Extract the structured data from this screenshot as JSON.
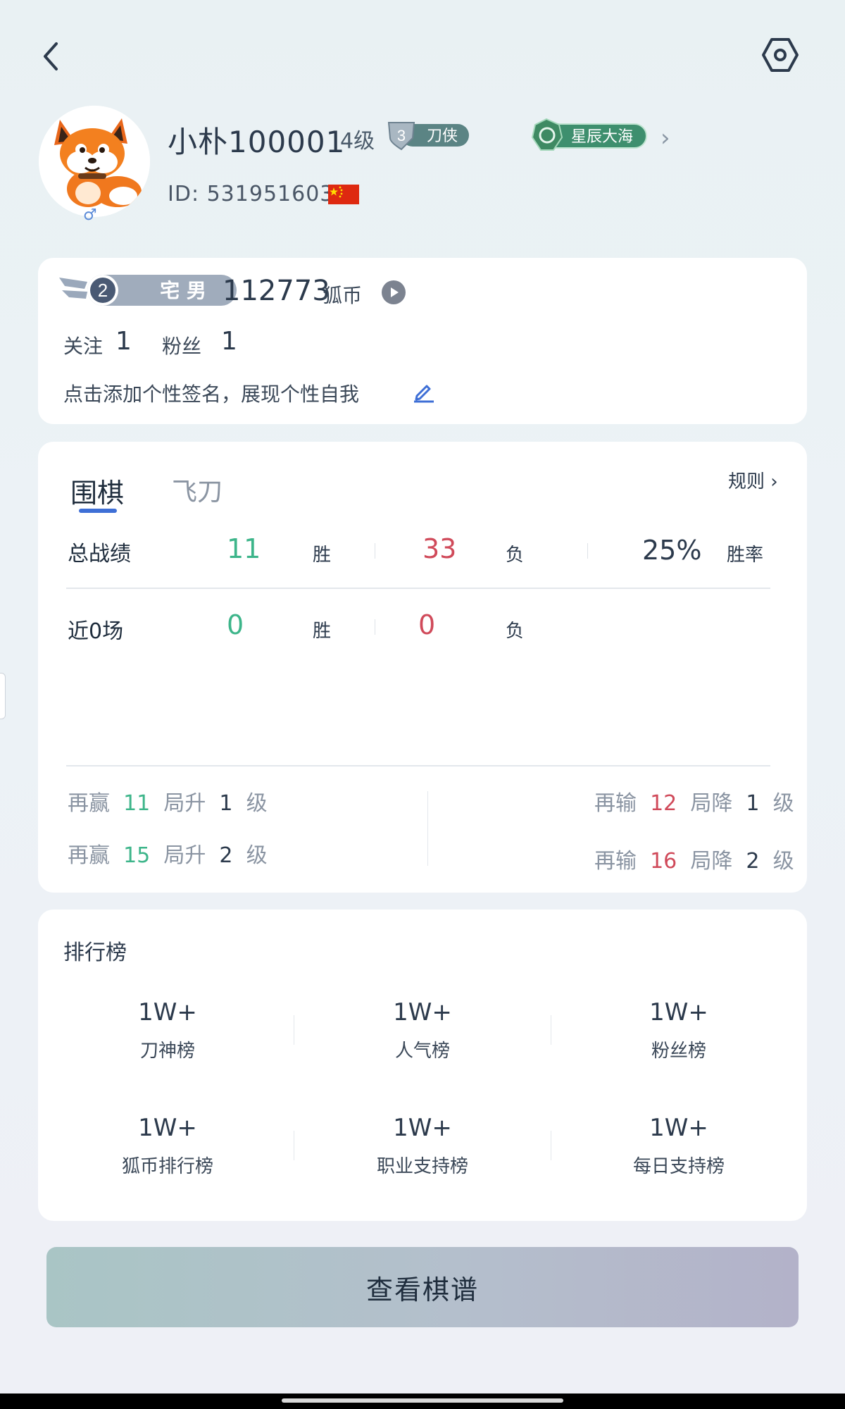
{
  "header": {
    "back_icon": "chevron-left-icon",
    "settings_icon": "hexagon-settings-icon"
  },
  "profile": {
    "username": "小朴100001",
    "level": "4级",
    "rank_badge": {
      "number": "3",
      "label": "刀侠"
    },
    "star_badge": {
      "label": "星辰大海"
    },
    "id_text": "ID: 531951603",
    "gender_symbol": "♂",
    "flag": "china-flag"
  },
  "info_card": {
    "title_badge": {
      "number": "2",
      "label": "宅 男"
    },
    "coins": "112773",
    "coin_label": "狐币",
    "follow_label": "关注",
    "follow_count": "1",
    "fans_label": "粉丝",
    "fans_count": "1",
    "signature": "点击添加个性签名，展现个性自我"
  },
  "stats_card": {
    "tabs": [
      {
        "label": "围棋",
        "active": true
      },
      {
        "label": "飞刀",
        "active": false
      }
    ],
    "rules_label": "规则",
    "total": {
      "label": "总战绩",
      "wins": "11",
      "win_label": "胜",
      "losses": "33",
      "loss_label": "负",
      "rate": "25%",
      "rate_label": "胜率"
    },
    "recent": {
      "label": "近0场",
      "wins": "0",
      "win_label": "胜",
      "losses": "0",
      "loss_label": "负"
    },
    "progress": {
      "up": [
        {
          "pre": "再赢",
          "count": "11",
          "mid": "局升",
          "level": "1",
          "suffix": "级"
        },
        {
          "pre": "再赢",
          "count": "15",
          "mid": "局升",
          "level": "2",
          "suffix": "级"
        }
      ],
      "down": [
        {
          "pre": "再输",
          "count": "12",
          "mid": "局降",
          "level": "1",
          "suffix": "级"
        },
        {
          "pre": "再输",
          "count": "16",
          "mid": "局降",
          "level": "2",
          "suffix": "级"
        }
      ]
    }
  },
  "leaderboard": {
    "title": "排行榜",
    "items": [
      {
        "value": "1W+",
        "name": "刀神榜"
      },
      {
        "value": "1W+",
        "name": "人气榜"
      },
      {
        "value": "1W+",
        "name": "粉丝榜"
      },
      {
        "value": "1W+",
        "name": "狐币排行榜"
      },
      {
        "value": "1W+",
        "name": "职业支持榜"
      },
      {
        "value": "1W+",
        "name": "每日支持榜"
      }
    ]
  },
  "footer": {
    "view_records": "查看棋谱"
  },
  "colors": {
    "win": "#3db58a",
    "loss": "#d04a5a",
    "tab_accent": "#3e6fd6"
  }
}
